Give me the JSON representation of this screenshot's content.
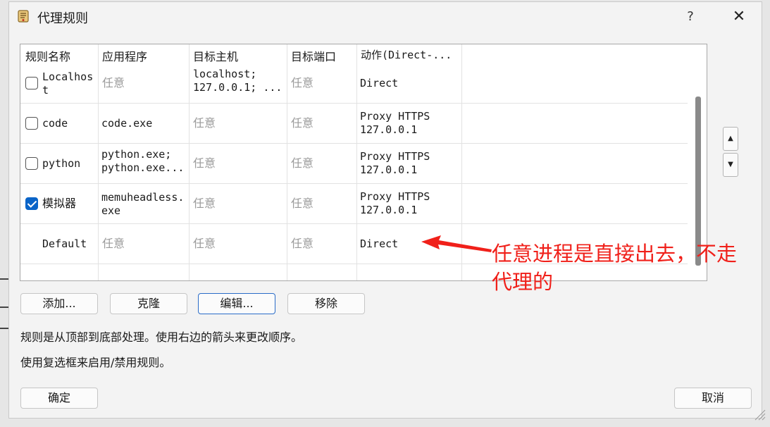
{
  "window": {
    "title": "代理规则",
    "help": "?",
    "close": "✕"
  },
  "columns": [
    "规则名称",
    "应用程序",
    "目标主机",
    "目标端口",
    "动作(Direct-..."
  ],
  "rows": [
    {
      "checked": false,
      "name": "Localhos\nt",
      "app": "任意",
      "host": "localhost;\n127.0.0.1; ...",
      "port": "任意",
      "action": "Direct"
    },
    {
      "checked": false,
      "name": "code",
      "app": "code.exe",
      "host": "任意",
      "port": "任意",
      "action": "Proxy HTTPS\n127.0.0.1"
    },
    {
      "checked": false,
      "name": "python",
      "app": "python.exe;\npython.exe...",
      "host": "任意",
      "port": "任意",
      "action": "Proxy HTTPS\n127.0.0.1"
    },
    {
      "checked": true,
      "name": "模拟器",
      "app": "memuheadless.\nexe",
      "host": "任意",
      "port": "任意",
      "action": "Proxy HTTPS\n127.0.0.1"
    },
    {
      "checked": null,
      "name": "Default",
      "app": "任意",
      "host": "任意",
      "port": "任意",
      "action": "Direct"
    }
  ],
  "buttons": {
    "add": "添加...",
    "clone": "克隆",
    "edit": "编辑...",
    "remove": "移除",
    "ok": "确定",
    "cancel": "取消"
  },
  "move": {
    "up": "▲",
    "down": "▼"
  },
  "info": {
    "line1": "规则是从顶部到底部处理。使用右边的箭头来更改顺序。",
    "line2": "使用复选框来启用/禁用规则。"
  },
  "annotation": {
    "text": "任意进程是直接出去，不走代理的",
    "color": "#f0201a"
  },
  "icons": {
    "title": "rules-scroll-icon",
    "checkbox_checked_color": "#0a64c8"
  }
}
